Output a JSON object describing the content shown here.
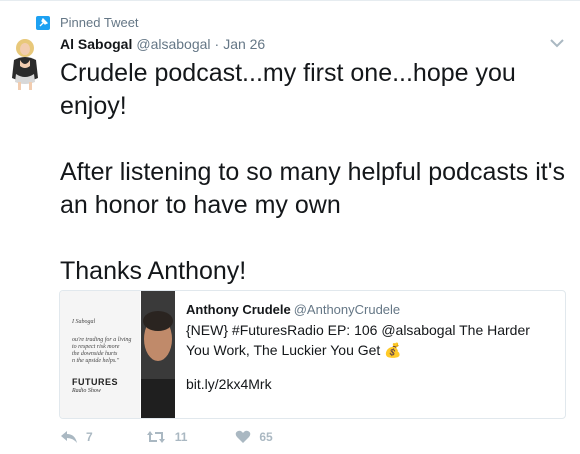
{
  "pinned": {
    "label": "Pinned Tweet",
    "icon": "pin-icon"
  },
  "author": {
    "full_name": "Al Sabogal",
    "username": "@alsabogal",
    "separator": "·",
    "time": "Jan 26"
  },
  "tweet": {
    "lines": [
      "Crudele podcast...my first one...hope you enjoy!",
      "After listening to so many helpful podcasts it's an honor to have my own",
      "Thanks Anthony!"
    ]
  },
  "quoted": {
    "name": "Anthony Crudele",
    "handle": "@AnthonyCrudele",
    "text": "{NEW} #FuturesRadio EP: 106 @alsabogal The Harder You Work, The Luckier You Get",
    "emoji": "💰",
    "link": "bit.ly/2kx4Mrk",
    "thumb": {
      "byline": "I Sabogal",
      "quote_lines": [
        "ou're trading for a living",
        "to respect risk more",
        "the downside hurts",
        "n the upside helps.\""
      ],
      "brand": "FUTURES",
      "brand_sub": "Radio Show"
    }
  },
  "actions": {
    "reply_count": "7",
    "retweet_count": "11",
    "like_count": "65"
  },
  "colors": {
    "accent": "#1da1f2",
    "muted": "#657786",
    "action_gray": "#aab8c2"
  }
}
